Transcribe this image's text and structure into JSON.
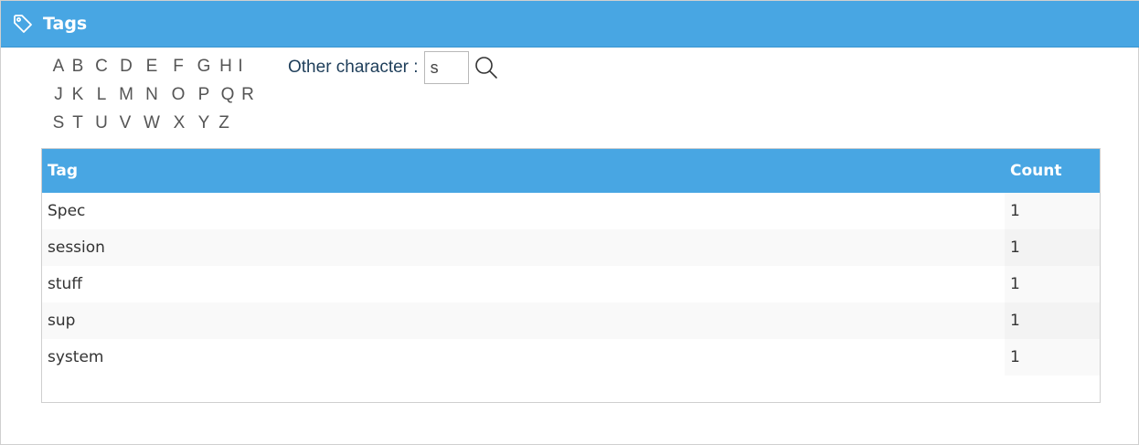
{
  "header": {
    "title": "Tags",
    "icon": "tag-icon",
    "background_color": "#48a6e3"
  },
  "alphabet": {
    "rows": [
      [
        "A",
        "B",
        "C",
        "D",
        "E",
        "F",
        "G",
        "H",
        "I"
      ],
      [
        "J",
        "K",
        "L",
        "M",
        "N",
        "O",
        "P",
        "Q",
        "R"
      ],
      [
        "S",
        "T",
        "U",
        "V",
        "W",
        "X",
        "Y",
        "Z"
      ]
    ]
  },
  "other_character": {
    "label": "Other character :",
    "value": "s",
    "search_icon": "search-icon"
  },
  "table": {
    "columns": [
      "Tag",
      "Count"
    ],
    "rows": [
      {
        "tag": "Spec",
        "count": "1"
      },
      {
        "tag": "session",
        "count": "1"
      },
      {
        "tag": "stuff",
        "count": "1"
      },
      {
        "tag": "sup",
        "count": "1"
      },
      {
        "tag": "system",
        "count": "1"
      }
    ]
  }
}
